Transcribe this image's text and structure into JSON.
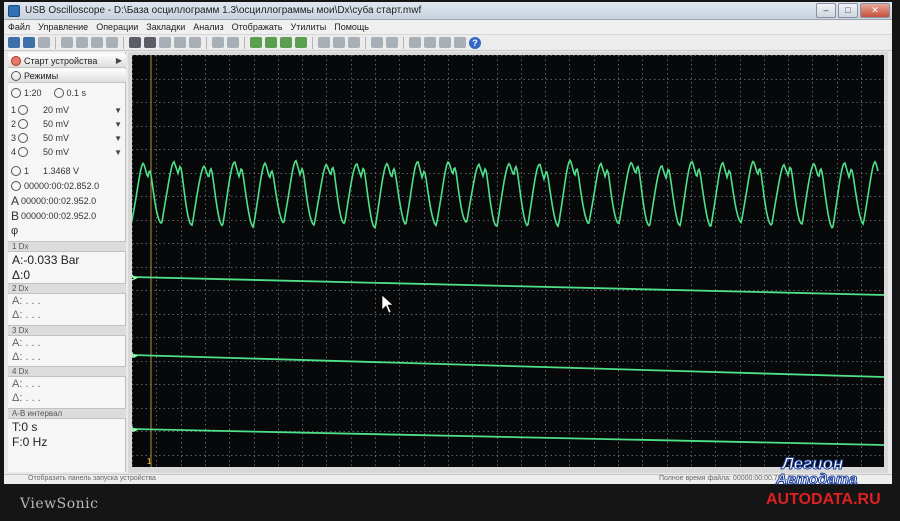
{
  "window": {
    "title": "USB Oscilloscope - D:\\База осциллограмм 1.3\\осциллограммы мои\\Dx\\суба старт.mwf",
    "buttons": {
      "minimize": "–",
      "maximize": "□",
      "close": "✕"
    }
  },
  "menu": [
    "Файл",
    "Управление",
    "Операции",
    "Закладки",
    "Анализ",
    "Отображать",
    "Утилиты",
    "Помощь"
  ],
  "left_panel": {
    "start_device": "Старт устройства",
    "modes": "Режимы",
    "time_scale": "1:20",
    "time_div": "0.1 s",
    "channels": [
      {
        "num": "1",
        "value": "20 mV"
      },
      {
        "num": "2",
        "value": "50 mV"
      },
      {
        "num": "3",
        "value": "50 mV"
      },
      {
        "num": "4",
        "value": "50 mV"
      }
    ],
    "trigger_channel": "1",
    "trigger_level": "1.3468 V",
    "trigger_time": "00000:00:02.852.0",
    "cursor_a_label": "A",
    "cursor_a_time": "00000:00:02.952.0",
    "cursor_b_label": "B",
    "cursor_b_time": "00000:00:02.952.0",
    "phi": "φ",
    "sections": [
      {
        "header": "1 Dx",
        "a": "A:-0.033 Bar",
        "d": "Δ:0"
      },
      {
        "header": "2 Dx",
        "a": "A: . . .",
        "d": "Δ: . . ."
      },
      {
        "header": "3 Dx",
        "a": "A: . . .",
        "d": "Δ: . . ."
      },
      {
        "header": "4 Dx",
        "a": "A: . . .",
        "d": "Δ: . . ."
      }
    ],
    "interval_header": "A-B интервал",
    "interval_t": "T:0 s",
    "interval_f": "F:0 Hz"
  },
  "scope": {
    "trace_color": "#4fe08a",
    "grid_color": "#7a7f84",
    "background": "#070809",
    "channel_markers": [
      "2",
      "3",
      "4"
    ],
    "cursor_marker": "1"
  },
  "status": {
    "left": "Отобразить панель запуска устройства",
    "right": "Полное время файла: 00000:00:00.794.8"
  },
  "bezel": {
    "brand": "ViewSonic"
  },
  "watermark": {
    "line1": "Легион",
    "line2": "Автодата",
    "line3": "AUTODATA.RU"
  }
}
